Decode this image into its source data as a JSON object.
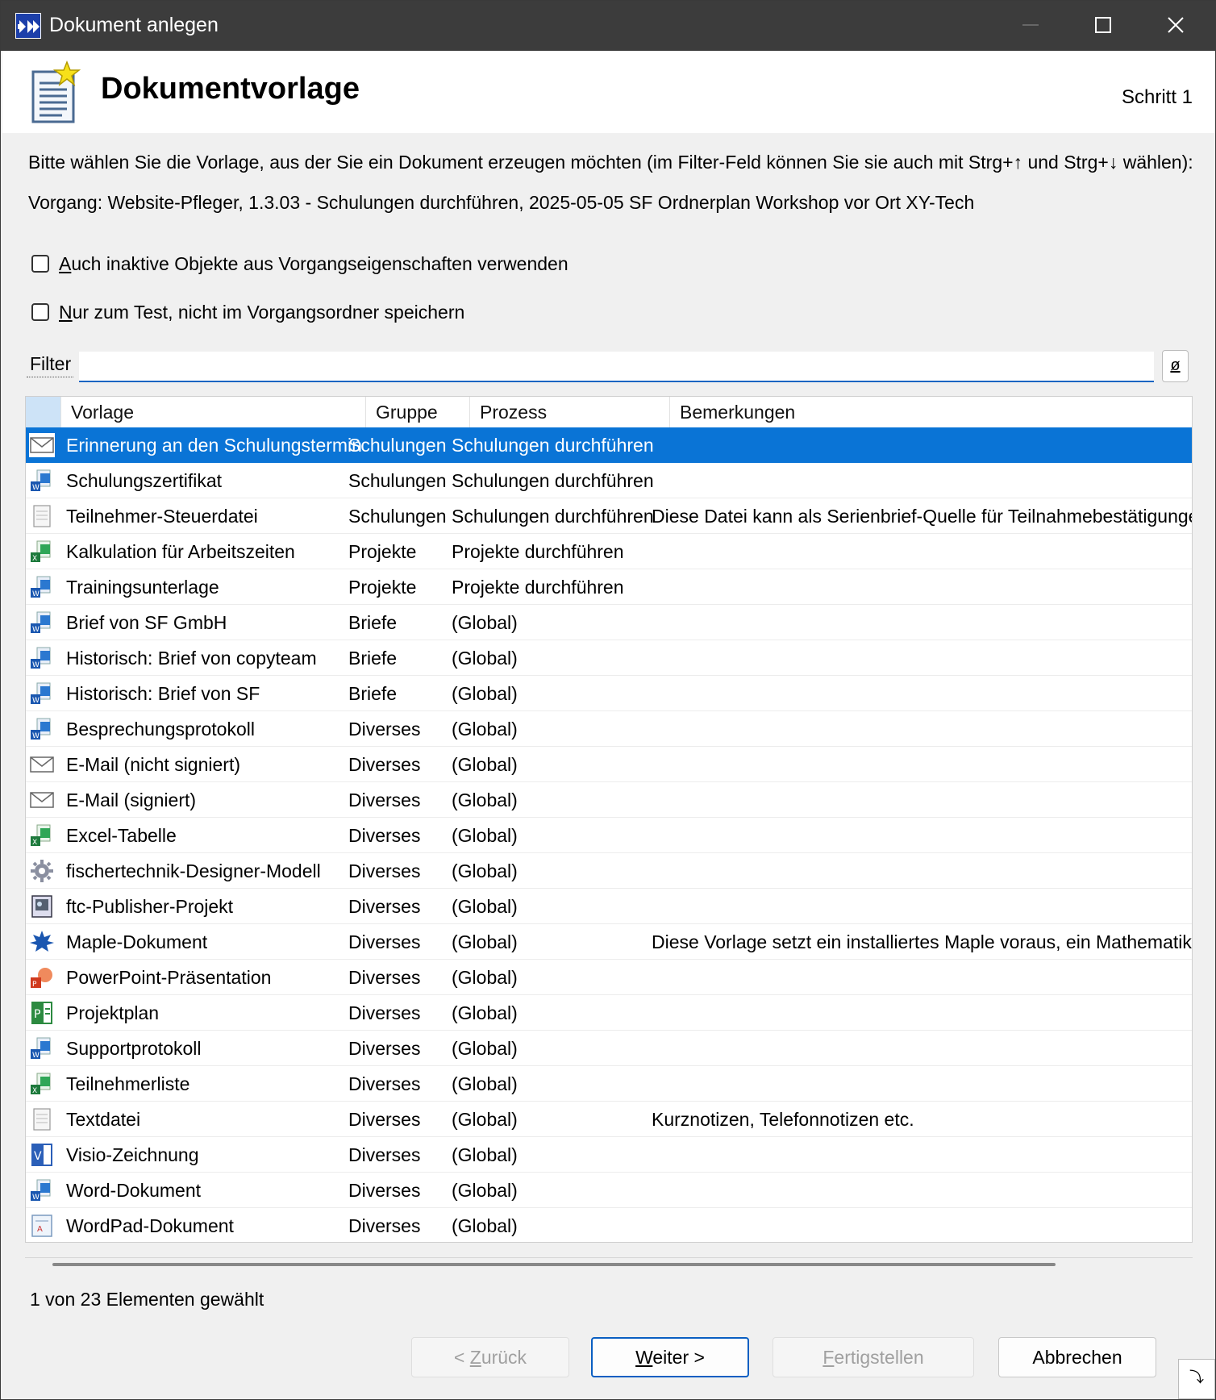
{
  "window": {
    "title": "Dokument anlegen",
    "accent": "#0a74d6",
    "titlebar_color": "#3c3c3c"
  },
  "header": {
    "title": "Dokumentvorlage",
    "step": "Schritt 1"
  },
  "instruction": "Bitte wählen Sie die Vorlage, aus der Sie ein Dokument erzeugen möchten (im Filter-Feld können Sie sie auch mit Strg+↑ und Strg+↓ wählen):",
  "process_info": "Vorgang: Website-Pfleger, 1.3.03 - Schulungen durchführen, 2025-05-05 SF Ordnerplan Workshop vor Ort XY-Tech",
  "options": {
    "inactive_objects_label": "Auch inaktive Objekte aus Vorgangseigenschaften verwenden",
    "inactive_objects_checked": false,
    "test_only_label": "Nur zum Test, nicht im Vorgangsordner speichern",
    "test_only_checked": false
  },
  "filter": {
    "label": "Filter",
    "value": "",
    "clear_glyph": "ø"
  },
  "table": {
    "columns": [
      "Vorlage",
      "Gruppe",
      "Prozess",
      "Bemerkungen"
    ],
    "rows": [
      {
        "icon": "mail-icon",
        "name": "Erinnerung an den Schulungstermin",
        "group": "Schulungen",
        "process": "Schulungen durchführen",
        "notes": "",
        "selected": true
      },
      {
        "icon": "word-icon",
        "name": "Schulungszertifikat",
        "group": "Schulungen",
        "process": "Schulungen durchführen",
        "notes": ""
      },
      {
        "icon": "text-file-icon",
        "name": "Teilnehmer-Steuerdatei",
        "group": "Schulungen",
        "process": "Schulungen durchführen",
        "notes": "Diese Datei kann als Serienbrief-Quelle für Teilnahmebestätigungen ver"
      },
      {
        "icon": "excel-icon",
        "name": "Kalkulation für Arbeitszeiten",
        "group": "Projekte",
        "process": "Projekte durchführen",
        "notes": ""
      },
      {
        "icon": "word-icon",
        "name": "Trainingsunterlage",
        "group": "Projekte",
        "process": "Projekte durchführen",
        "notes": ""
      },
      {
        "icon": "word-icon",
        "name": "Brief von SF GmbH",
        "group": "Briefe",
        "process": "(Global)",
        "notes": ""
      },
      {
        "icon": "word-icon",
        "name": "Historisch: Brief von copyteam",
        "group": "Briefe",
        "process": "(Global)",
        "notes": ""
      },
      {
        "icon": "word-icon",
        "name": "Historisch: Brief von SF",
        "group": "Briefe",
        "process": "(Global)",
        "notes": ""
      },
      {
        "icon": "word-icon",
        "name": "Besprechungsprotokoll",
        "group": "Diverses",
        "process": "(Global)",
        "notes": ""
      },
      {
        "icon": "mail-icon",
        "name": "E-Mail (nicht signiert)",
        "group": "Diverses",
        "process": "(Global)",
        "notes": ""
      },
      {
        "icon": "mail-icon",
        "name": "E-Mail (signiert)",
        "group": "Diverses",
        "process": "(Global)",
        "notes": ""
      },
      {
        "icon": "excel-icon",
        "name": "Excel-Tabelle",
        "group": "Diverses",
        "process": "(Global)",
        "notes": ""
      },
      {
        "icon": "gear-icon",
        "name": "fischertechnik-Designer-Modell",
        "group": "Diverses",
        "process": "(Global)",
        "notes": ""
      },
      {
        "icon": "publisher-icon",
        "name": "ftc-Publisher-Projekt",
        "group": "Diverses",
        "process": "(Global)",
        "notes": ""
      },
      {
        "icon": "maple-leaf-icon",
        "name": "Maple-Dokument",
        "group": "Diverses",
        "process": "(Global)",
        "notes": "Diese Vorlage setzt ein installiertes Maple voraus, ein Mathematik-Progra"
      },
      {
        "icon": "powerpoint-icon",
        "name": "PowerPoint-Präsentation",
        "group": "Diverses",
        "process": "(Global)",
        "notes": ""
      },
      {
        "icon": "project-icon",
        "name": "Projektplan",
        "group": "Diverses",
        "process": "(Global)",
        "notes": ""
      },
      {
        "icon": "word-icon",
        "name": "Supportprotokoll",
        "group": "Diverses",
        "process": "(Global)",
        "notes": ""
      },
      {
        "icon": "excel-icon",
        "name": "Teilnehmerliste",
        "group": "Diverses",
        "process": "(Global)",
        "notes": ""
      },
      {
        "icon": "text-file-icon",
        "name": "Textdatei",
        "group": "Diverses",
        "process": "(Global)",
        "notes": "Kurznotizen, Telefonnotizen etc."
      },
      {
        "icon": "visio-icon",
        "name": "Visio-Zeichnung",
        "group": "Diverses",
        "process": "(Global)",
        "notes": ""
      },
      {
        "icon": "word-icon",
        "name": "Word-Dokument",
        "group": "Diverses",
        "process": "(Global)",
        "notes": ""
      },
      {
        "icon": "wordpad-icon",
        "name": "WordPad-Dokument",
        "group": "Diverses",
        "process": "(Global)",
        "notes": ""
      }
    ]
  },
  "status": "1 von 23 Elementen gewählt",
  "buttons": {
    "back": {
      "prefix": "< ",
      "key": "Z",
      "rest": "urück",
      "disabled": true
    },
    "next": {
      "key": "W",
      "rest": "eiter >",
      "disabled": false
    },
    "finish": {
      "key": "F",
      "rest": "ertigstellen",
      "disabled": true
    },
    "cancel": {
      "label": "Abbrechen",
      "disabled": false
    }
  }
}
